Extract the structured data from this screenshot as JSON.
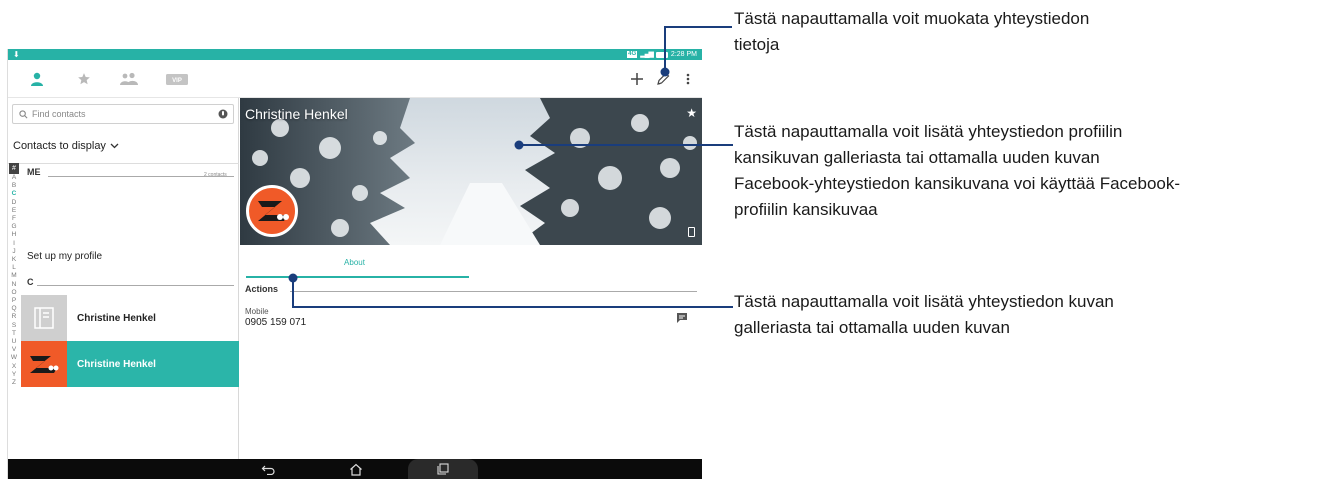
{
  "colors": {
    "accent": "#27b2a6",
    "selected_row": "#2bb5a9",
    "callout_line": "#1a3d7c"
  },
  "status_bar": {
    "network": "4G",
    "time": "2:28 PM"
  },
  "app_bar": {
    "tabs": [
      "contacts-tab",
      "favorites-tab",
      "groups-tab",
      "vip-tab"
    ],
    "vip_label": "VIP",
    "actions": [
      "add-icon",
      "edit-pencil-icon",
      "more-vert-icon"
    ]
  },
  "search": {
    "placeholder": "Find contacts",
    "value": ""
  },
  "display_dropdown": {
    "label": "Contacts to display"
  },
  "alphabet": [
    "A",
    "B",
    "C",
    "D",
    "E",
    "F",
    "G",
    "H",
    "I",
    "J",
    "K",
    "L",
    "M",
    "N",
    "O",
    "P",
    "Q",
    "R",
    "S",
    "T",
    "U",
    "V",
    "W",
    "X",
    "Y",
    "Z"
  ],
  "alphabet_hash": "#",
  "alphabet_active": "C",
  "sections": {
    "me": {
      "header": "ME",
      "count": "2 contacts",
      "setup_label": "Set up my profile"
    },
    "c": {
      "header": "C"
    }
  },
  "contacts": [
    {
      "name": "Christine Henkel",
      "selected": false,
      "photo": "placeholder-card-icon"
    },
    {
      "name": "Christine Henkel",
      "selected": true,
      "photo": "orange-logo"
    }
  ],
  "detail": {
    "name": "Christine Henkel",
    "tab": "About",
    "actions_header": "Actions",
    "phone_type": "Mobile",
    "phone": "0905 159 071"
  },
  "callouts": {
    "edit": [
      "Tästä napauttamalla voit muokata yhteystiedon",
      "tietoja"
    ],
    "cover": [
      "Tästä napauttamalla voit lisätä yhteystiedon profiilin",
      "kansikuvan galleriasta tai ottamalla uuden kuvan",
      "Facebook-yhteystiedon kansikuvana voi käyttää Facebook-",
      "profiilin kansikuvaa"
    ],
    "photo": [
      "Tästä napauttamalla voit lisätä yhteystiedon kuvan",
      "galleriasta tai ottamalla uuden kuvan"
    ]
  }
}
